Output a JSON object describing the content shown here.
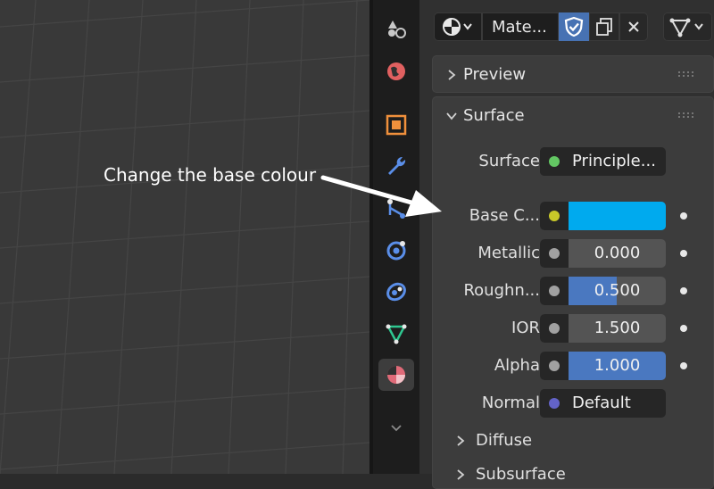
{
  "annotation": {
    "text": "Change the base colour"
  },
  "header": {
    "material_name": "Mate..."
  },
  "preview": {
    "label": "Preview"
  },
  "surface": {
    "label": "Surface",
    "rows": [
      {
        "label": "Surface",
        "value": "Principle...",
        "socket_color": "#63c763"
      },
      {
        "label": "Base C...",
        "value": "",
        "socket_color": "#c7c729",
        "swatch_color": "#00aaee"
      },
      {
        "label": "Metallic",
        "value": "0.000",
        "socket_color": "#a1a1a1",
        "fill": 0.0
      },
      {
        "label": "Roughn...",
        "value": "0.500",
        "socket_color": "#a1a1a1",
        "fill": 0.5
      },
      {
        "label": "IOR",
        "value": "1.500",
        "socket_color": "#a1a1a1",
        "fill": 0.0
      },
      {
        "label": "Alpha",
        "value": "1.000",
        "socket_color": "#a1a1a1",
        "fill": 1.0
      },
      {
        "label": "Normal",
        "value": "Default",
        "socket_color": "#6363c7"
      }
    ],
    "subpanels": [
      {
        "label": "Diffuse"
      },
      {
        "label": "Subsurface"
      }
    ]
  },
  "colors": {
    "accent": "#4772b3",
    "slider_fill": "#4a78c0"
  },
  "tabs": [
    {
      "icon": "scene-icon",
      "color": "#c8c8c8"
    },
    {
      "icon": "world-icon",
      "color": "#e06060"
    },
    {
      "icon": "object-icon",
      "color": "#f0903c"
    },
    {
      "icon": "modifier-icon",
      "color": "#5a8ee8"
    },
    {
      "icon": "particles-icon",
      "color": "#5a8ee8"
    },
    {
      "icon": "physics-icon",
      "color": "#5a8ee8"
    },
    {
      "icon": "constraints-icon",
      "color": "#5a8ee8"
    },
    {
      "icon": "object-data-icon",
      "color": "#2ec790"
    },
    {
      "icon": "material-icon",
      "color": "#e06a78"
    }
  ]
}
